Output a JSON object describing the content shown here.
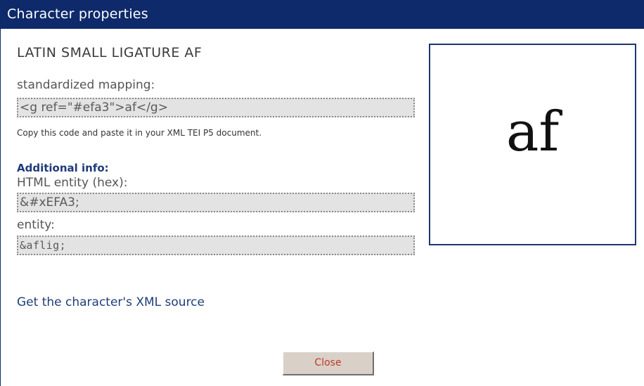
{
  "window": {
    "title": "Character properties"
  },
  "character": {
    "name": "LATIN SMALL LIGATURE AF",
    "glyph": "af"
  },
  "standardized_mapping": {
    "label": "standardized mapping:",
    "value": "<g ref=\"#efa3\">af</g>"
  },
  "hint": "Copy this code and paste it in your XML TEI P5 document.",
  "additional_info": {
    "title": "Additional info:",
    "html_entity_label": "HTML entity (hex):",
    "html_entity_value": "&#xEFA3;",
    "entity_label": "entity:",
    "entity_value": "&aflig;"
  },
  "links": {
    "xml_source": "Get the character's XML source"
  },
  "buttons": {
    "close": "Close"
  },
  "colors": {
    "titlebar": "#0e2a6b",
    "accent_text": "#1e3a78",
    "codebox_bg": "#e3e3e3",
    "close_text": "#c0392b"
  }
}
